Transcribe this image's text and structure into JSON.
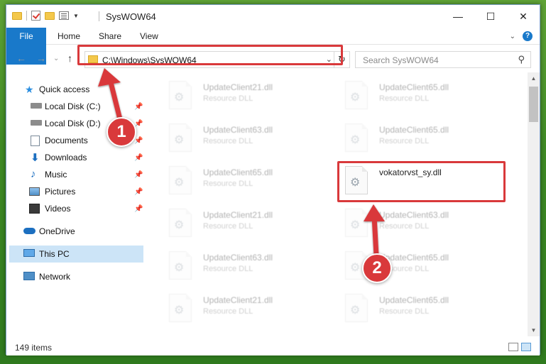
{
  "window": {
    "title": "SysWOW64",
    "controls": {
      "minimize": "—",
      "maximize": "☐",
      "close": "✕"
    }
  },
  "ribbon": {
    "tabs": [
      {
        "label": "File",
        "active": true
      },
      {
        "label": "Home"
      },
      {
        "label": "Share"
      },
      {
        "label": "View"
      }
    ],
    "accent_color": "#1979ca"
  },
  "address": {
    "path": "C:\\Windows\\SysWOW64",
    "back": "←",
    "forward": "→",
    "up": "↑",
    "dropdown": "⌄",
    "refresh": "↻"
  },
  "search": {
    "placeholder": "Search SysWOW64",
    "icon": "search-icon"
  },
  "nav_pane": {
    "items": [
      {
        "label": "Quick access",
        "icon": "star-icon",
        "pinned": false
      },
      {
        "label": "Local Disk (C:)",
        "icon": "drive-icon",
        "pinned": true
      },
      {
        "label": "Local Disk (D:)",
        "icon": "drive-icon",
        "pinned": true
      },
      {
        "label": "Documents",
        "icon": "documents-icon",
        "pinned": true
      },
      {
        "label": "Downloads",
        "icon": "downloads-icon",
        "pinned": true
      },
      {
        "label": "Music",
        "icon": "music-icon",
        "pinned": true
      },
      {
        "label": "Pictures",
        "icon": "pictures-icon",
        "pinned": true
      },
      {
        "label": "Videos",
        "icon": "videos-icon",
        "pinned": true
      },
      {
        "label": "OneDrive",
        "icon": "onedrive-icon",
        "pinned": false
      },
      {
        "label": "This PC",
        "icon": "pc-icon",
        "pinned": false,
        "selected": true
      },
      {
        "label": "Network",
        "icon": "network-icon",
        "pinned": false
      }
    ]
  },
  "files": {
    "left_column": [
      {
        "name": "UpdateClient21.dll",
        "type": "Resource DLL"
      },
      {
        "name": "UpdateClient63.dll",
        "type": "Resource DLL"
      },
      {
        "name": "UpdateClient65.dll",
        "type": "Resource DLL"
      },
      {
        "name": "UpdateClient21.dll",
        "type": "Resource DLL"
      },
      {
        "name": "UpdateClient63.dll",
        "type": "Resource DLL"
      },
      {
        "name": "UpdateClient21.dll",
        "type": "Resource DLL"
      }
    ],
    "right_column": [
      {
        "name": "UpdateClient65.dll",
        "type": "Resource DLL"
      },
      {
        "name": "UpdateClient65.dll",
        "type": "Resource DLL"
      },
      {
        "name": "vokatorvst_sy.dll",
        "type": "",
        "highlighted": true
      },
      {
        "name": "UpdateClient63.dll",
        "type": "Resource DLL"
      },
      {
        "name": "UpdateClient65.dll",
        "type": "Resource DLL"
      },
      {
        "name": "UpdateClient65.dll",
        "type": "Resource DLL"
      }
    ]
  },
  "status": {
    "item_count": "149 items"
  },
  "callouts": [
    {
      "number": "1",
      "color": "#d9393b"
    },
    {
      "number": "2",
      "color": "#d9393b"
    }
  ]
}
